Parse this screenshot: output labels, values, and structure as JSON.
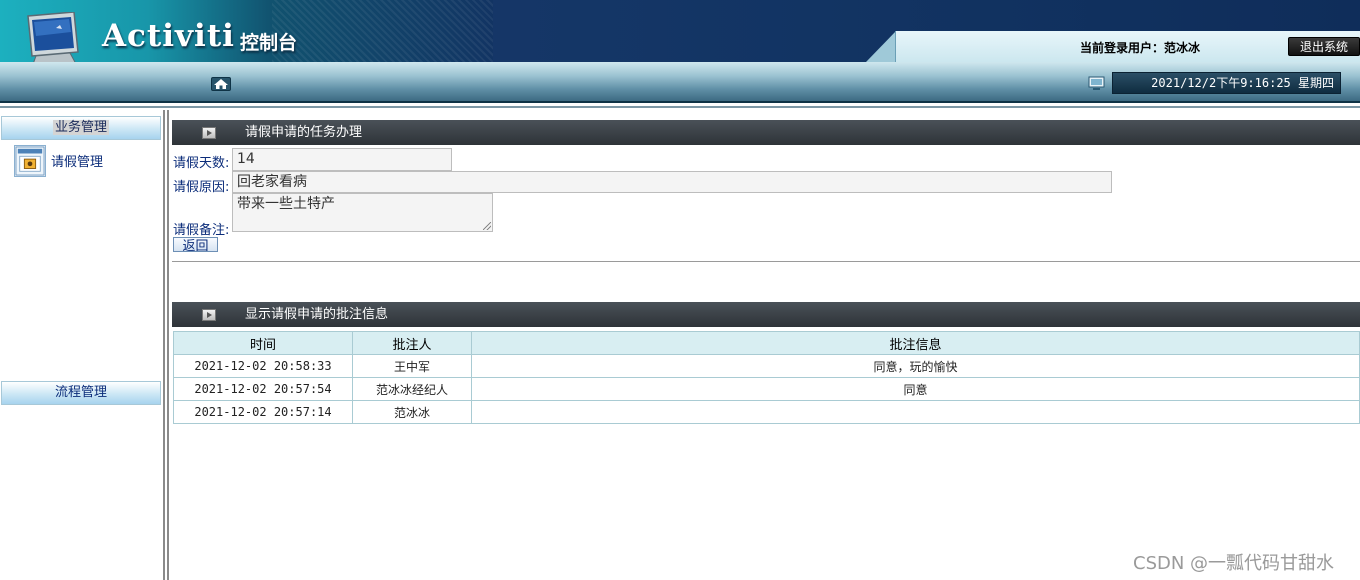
{
  "header": {
    "app_title": "Activiti",
    "app_subtitle": "控制台",
    "current_user_label": "当前登录用户：范冰冰",
    "logout_label": "退出系统",
    "datetime": "2021/12/2下午9:16:25 星期四"
  },
  "sidebar": {
    "business_label": "业务管理",
    "leave_item_label": "请假管理",
    "process_label": "流程管理"
  },
  "task_section": {
    "title": "请假申请的任务办理",
    "days_label": "请假天数:",
    "days_value": "14",
    "reason_label": "请假原因:",
    "reason_value": "回老家看病",
    "remark_label": "请假备注:",
    "remark_value": "带来一些土特产",
    "back_label": "返回"
  },
  "notes_section": {
    "title": "显示请假申请的批注信息",
    "columns": [
      "时间",
      "批注人",
      "批注信息"
    ],
    "rows": [
      {
        "time": "2021-12-02 20:58:33",
        "author": "王中军",
        "message": "同意，玩的愉快"
      },
      {
        "time": "2021-12-02 20:57:54",
        "author": "范冰冰经纪人",
        "message": "同意"
      },
      {
        "time": "2021-12-02 20:57:14",
        "author": "范冰冰",
        "message": ""
      }
    ]
  },
  "watermark": "CSDN @一瓢代码甘甜水"
}
